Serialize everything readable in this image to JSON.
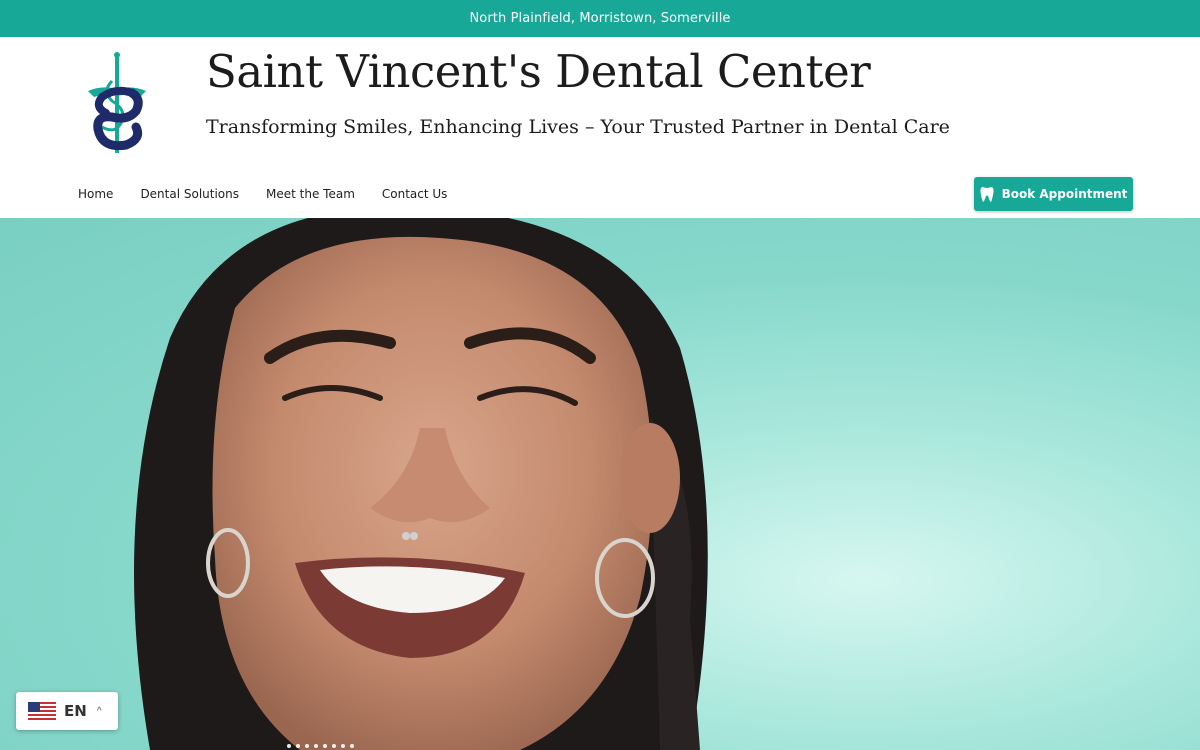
{
  "topbar": {
    "locations": "North Plainfield,  Morristown, Somerville"
  },
  "header": {
    "logo_icon": "caduceus-tooth-logo",
    "title": "Saint Vincent's Dental Center",
    "tagline": "Transforming Smiles, Enhancing Lives – Your Trusted Partner in Dental Care"
  },
  "nav": {
    "items": [
      {
        "label": "Home"
      },
      {
        "label": "Dental Solutions"
      },
      {
        "label": "Meet the Team"
      },
      {
        "label": "Contact Us"
      }
    ]
  },
  "cta": {
    "label": "Book Appointment",
    "icon": "tooth-icon"
  },
  "hero": {
    "image": "smiling woman with hoop earrings and septum ring on teal background",
    "slide_count": 8
  },
  "language": {
    "code": "EN",
    "flag": "us-flag-icon",
    "caret": "^"
  },
  "colors": {
    "brand_teal": "#17a897",
    "logo_navy": "#1f2a6b",
    "hero_bg": "#86d8cb"
  }
}
